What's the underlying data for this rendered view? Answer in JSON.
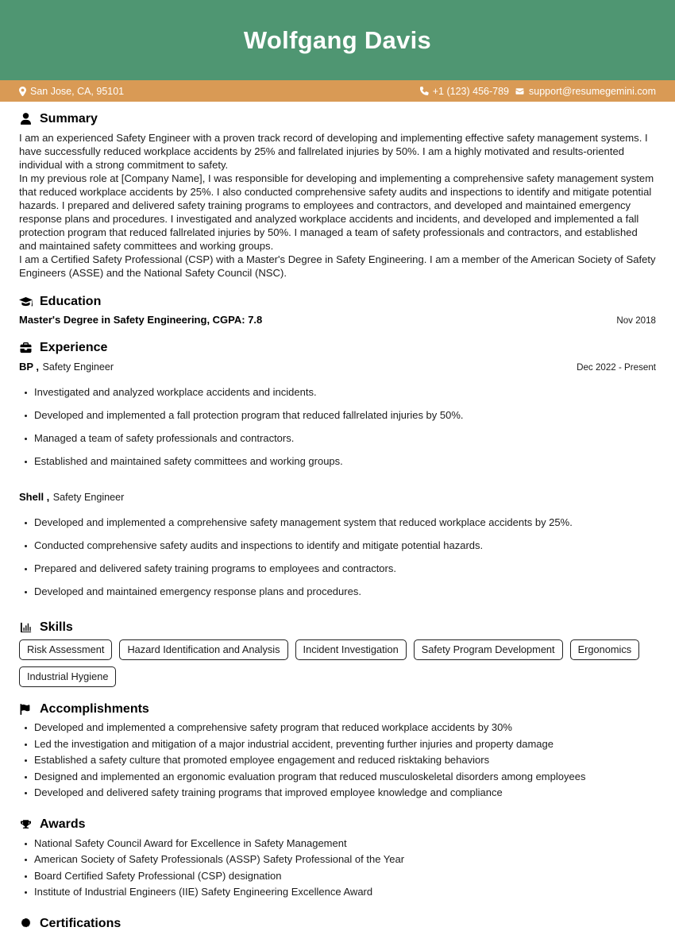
{
  "header": {
    "full_name": "Wolfgang Davis",
    "band_color": "#4f9672",
    "contact_band_color": "#d99a55",
    "location": "San Jose, CA, 95101",
    "phone": "+1 (123) 456-789",
    "email": "support@resumegemini.com",
    "location_icon": "map-pin-icon",
    "phone_icon": "phone-icon",
    "email_icon": "envelope-icon"
  },
  "summary": {
    "title": "Summary",
    "icon": "person-icon",
    "paragraphs": [
      "I am an experienced Safety Engineer with a proven track record of developing and implementing effective safety management systems. I have successfully reduced workplace accidents by 25% and fallrelated injuries by 50%. I am a highly motivated and results-oriented individual with a strong commitment to safety.",
      "In my previous role at [Company Name], I was responsible for developing and implementing a comprehensive safety management system that reduced workplace accidents by 25%. I also conducted comprehensive safety audits and inspections to identify and mitigate potential hazards. I prepared and delivered safety training programs to employees and contractors, and developed and maintained emergency response plans and procedures. I investigated and analyzed workplace accidents and incidents, and developed and implemented a fall protection program that reduced fallrelated injuries by 50%. I managed a team of safety professionals and contractors, and established and maintained safety committees and working groups.",
      "I am a Certified Safety Professional (CSP) with a Master's Degree in Safety Engineering. I am a member of the American Society of Safety Engineers (ASSE) and the National Safety Council (NSC)."
    ]
  },
  "education": {
    "title": "Education",
    "icon": "graduation-cap-icon",
    "entries": [
      {
        "degree": "Master's Degree in Safety Engineering, CGPA: 7.8",
        "date": "Nov 2018"
      }
    ]
  },
  "experience": {
    "title": "Experience",
    "icon": "briefcase-icon",
    "entries": [
      {
        "company": "BP ,",
        "role": "Safety Engineer",
        "date": "Dec 2022 - Present",
        "bullets": [
          "Investigated and analyzed workplace accidents and incidents.",
          "Developed and implemented a fall protection program that reduced fallrelated injuries by 50%.",
          "Managed a team of safety professionals and contractors.",
          "Established and maintained safety committees and working groups."
        ]
      },
      {
        "company": "Shell ,",
        "role": "Safety Engineer",
        "date": "",
        "bullets": [
          "Developed and implemented a comprehensive safety management system that reduced workplace accidents by 25%.",
          "Conducted comprehensive safety audits and inspections to identify and mitigate potential hazards.",
          "Prepared and delivered safety training programs to employees and contractors.",
          "Developed and maintained emergency response plans and procedures."
        ]
      }
    ]
  },
  "skills": {
    "title": "Skills",
    "icon": "bar-chart-icon",
    "items": [
      "Risk Assessment",
      "Hazard Identification and Analysis",
      "Incident Investigation",
      "Safety Program Development",
      "Ergonomics",
      "Industrial Hygiene"
    ]
  },
  "accomplishments": {
    "title": "Accomplishments",
    "icon": "flag-icon",
    "items": [
      "Developed and implemented a comprehensive safety program that reduced workplace accidents by 30%",
      "Led the investigation and mitigation of a major industrial accident, preventing further injuries and property damage",
      "Established a safety culture that promoted employee engagement and reduced risktaking behaviors",
      "Designed and implemented an ergonomic evaluation program that reduced musculoskeletal disorders among employees",
      "Developed and delivered safety training programs that improved employee knowledge and compliance"
    ]
  },
  "awards": {
    "title": "Awards",
    "icon": "trophy-icon",
    "items": [
      "National Safety Council Award for Excellence in Safety Management",
      "American Society of Safety Professionals (ASSP) Safety Professional of the Year",
      "Board Certified Safety Professional (CSP) designation",
      "Institute of Industrial Engineers (IIE) Safety Engineering Excellence Award"
    ]
  },
  "certifications": {
    "title": "Certifications",
    "icon": "certificate-seal-icon"
  }
}
